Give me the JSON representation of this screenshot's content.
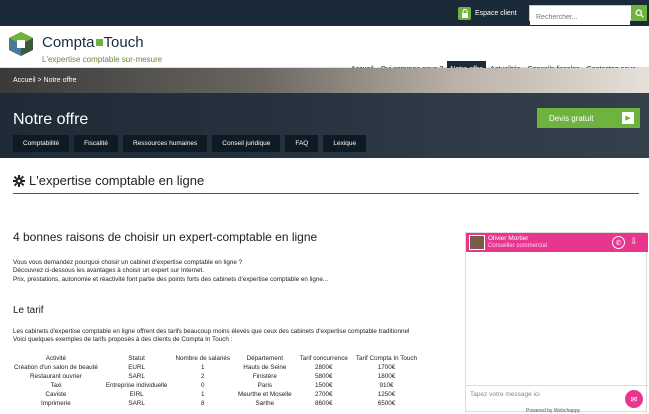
{
  "topbar": {
    "espace_client": "Espace client",
    "search_placeholder": "Rechercher..."
  },
  "header": {
    "brand_left": "Compta",
    "brand_right": "Touch",
    "tagline": "L'expertise comptable sur-mesure",
    "nav": [
      "Accueil",
      "Qui sommes-nous ?",
      "Notre offre",
      "Actualités",
      "Conseils fiscales",
      "Contactez-nous"
    ],
    "nav_active": "Notre offre"
  },
  "hero": {
    "breadcrumb": "Accueil > Notre offre",
    "title": "Notre offre",
    "cta": "Devis gratuit",
    "subnav": [
      "Comptabilité",
      "Fiscalité",
      "Ressources humaines",
      "Conseil juridique",
      "FAQ",
      "Lexique"
    ]
  },
  "content": {
    "section_title": "L'expertise comptable en ligne",
    "h2": "4 bonnes raisons de choisir un expert-comptable en ligne",
    "para": [
      "Vous vous demandez pourquoi choisir un cabinet d'expertise comptable en ligne ?",
      "Découvrez ci-dessous les avantages à choisir un expert sur Internet.",
      "Prix, prestations, autonomie et réactivité font partie des points forts des cabinets d'expertise comptable en ligne..."
    ],
    "h3": "Le tarif",
    "para2": [
      "Les cabinets d'expertise comptable en ligne offrent des tarifs beaucoup moins élevés que ceux des cabinets d'expertise comptable traditionnel",
      "Voici quelques exemples de tarifs proposés à des clients de Compta In Touch :"
    ]
  },
  "table": {
    "headers": [
      "Activité",
      "Statut",
      "Nombre de salariés",
      "Département",
      "Tarif concurrence",
      "Tarif Compta In Touch"
    ],
    "rows": [
      [
        "Création d'un salon de beauté",
        "EURL",
        "1",
        "Hauts de Seine",
        "2800€",
        "1700€"
      ],
      [
        "Restaurant ouvrier",
        "SARL",
        "2",
        "Finistère",
        "5800€",
        "1800€"
      ],
      [
        "Taxi",
        "Entreprise individuelle",
        "0",
        "Paris",
        "1500€",
        "910€"
      ],
      [
        "Caviste",
        "EIRL",
        "1",
        "Meurthe et Moselle",
        "2700€",
        "1250€"
      ],
      [
        "Imprimerie",
        "SARL",
        "8",
        "Sarthe",
        "8600€",
        "6500€"
      ]
    ]
  },
  "chat": {
    "agent_name": "Olivier Mortier",
    "agent_role": "Conseiller commercial",
    "input_placeholder": "Tapez votre message ici",
    "powered": "Powered by Webchappy"
  },
  "colors": {
    "navy": "#1b2a38",
    "green": "#6fb33f",
    "pink": "#e8368f"
  }
}
